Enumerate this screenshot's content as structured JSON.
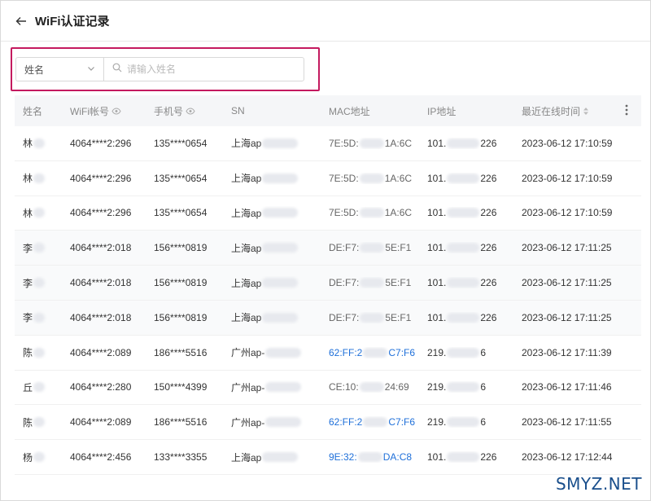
{
  "header": {
    "title": "WiFi认证记录"
  },
  "filter": {
    "field_label": "姓名",
    "search_placeholder": "请输入姓名"
  },
  "columns": {
    "name": "姓名",
    "wifi": "WiFi帐号",
    "phone": "手机号",
    "sn": "SN",
    "mac": "MAC地址",
    "ip": "IP地址",
    "time": "最近在线时间"
  },
  "rows": [
    {
      "name": "林",
      "wifi": "4064****2:296",
      "phone": "135****0654",
      "sn": "上海ap",
      "mac_a": "7E:5D:",
      "mac_b": "1A:6C",
      "mac_link": false,
      "ip_a": "101.",
      "ip_b": "226",
      "time": "2023-06-12 17:10:59"
    },
    {
      "name": "林",
      "wifi": "4064****2:296",
      "phone": "135****0654",
      "sn": "上海ap",
      "mac_a": "7E:5D:",
      "mac_b": "1A:6C",
      "mac_link": false,
      "ip_a": "101.",
      "ip_b": "226",
      "time": "2023-06-12 17:10:59"
    },
    {
      "name": "林",
      "wifi": "4064****2:296",
      "phone": "135****0654",
      "sn": "上海ap",
      "mac_a": "7E:5D:",
      "mac_b": "1A:6C",
      "mac_link": false,
      "ip_a": "101.",
      "ip_b": "226",
      "time": "2023-06-12 17:10:59"
    },
    {
      "name": "李",
      "wifi": "4064****2:018",
      "phone": "156****0819",
      "sn": "上海ap",
      "mac_a": "DE:F7:",
      "mac_b": "5E:F1",
      "mac_link": false,
      "ip_a": "101.",
      "ip_b": "226",
      "time": "2023-06-12 17:11:25"
    },
    {
      "name": "李",
      "wifi": "4064****2:018",
      "phone": "156****0819",
      "sn": "上海ap",
      "mac_a": "DE:F7:",
      "mac_b": "5E:F1",
      "mac_link": false,
      "ip_a": "101.",
      "ip_b": "226",
      "time": "2023-06-12 17:11:25"
    },
    {
      "name": "李",
      "wifi": "4064****2:018",
      "phone": "156****0819",
      "sn": "上海ap",
      "mac_a": "DE:F7:",
      "mac_b": "5E:F1",
      "mac_link": false,
      "ip_a": "101.",
      "ip_b": "226",
      "time": "2023-06-12 17:11:25"
    },
    {
      "name": "陈",
      "wifi": "4064****2:089",
      "phone": "186****5516",
      "sn": "广州ap-",
      "mac_a": "62:FF:2",
      "mac_b": "C7:F6",
      "mac_link": true,
      "ip_a": "219.",
      "ip_b": "6",
      "time": "2023-06-12 17:11:39"
    },
    {
      "name": "丘",
      "wifi": "4064****2:280",
      "phone": "150****4399",
      "sn": "广州ap-",
      "mac_a": "CE:10:",
      "mac_b": "24:69",
      "mac_link": false,
      "ip_a": "219.",
      "ip_b": "6",
      "time": "2023-06-12 17:11:46"
    },
    {
      "name": "陈",
      "wifi": "4064****2:089",
      "phone": "186****5516",
      "sn": "广州ap-",
      "mac_a": "62:FF:2",
      "mac_b": "C7:F6",
      "mac_link": true,
      "ip_a": "219.",
      "ip_b": "6",
      "time": "2023-06-12 17:11:55"
    },
    {
      "name": "杨",
      "wifi": "4064****2:456",
      "phone": "133****3355",
      "sn": "上海ap",
      "mac_a": "9E:32:",
      "mac_b": "DA:C8",
      "mac_link": true,
      "ip_a": "101.",
      "ip_b": "226",
      "time": "2023-06-12 17:12:44"
    }
  ],
  "icons": {
    "back": "arrow-left-icon",
    "eye": "eye-icon",
    "sort": "sort-icon",
    "menu": "kebab-menu-icon",
    "search": "search-icon",
    "chevron": "chevron-down-icon"
  },
  "colors": {
    "highlight_border": "#c41a5f",
    "link": "#1e6fd9",
    "header_bg": "#f5f6f8"
  },
  "watermark": "SMYZ.NET"
}
